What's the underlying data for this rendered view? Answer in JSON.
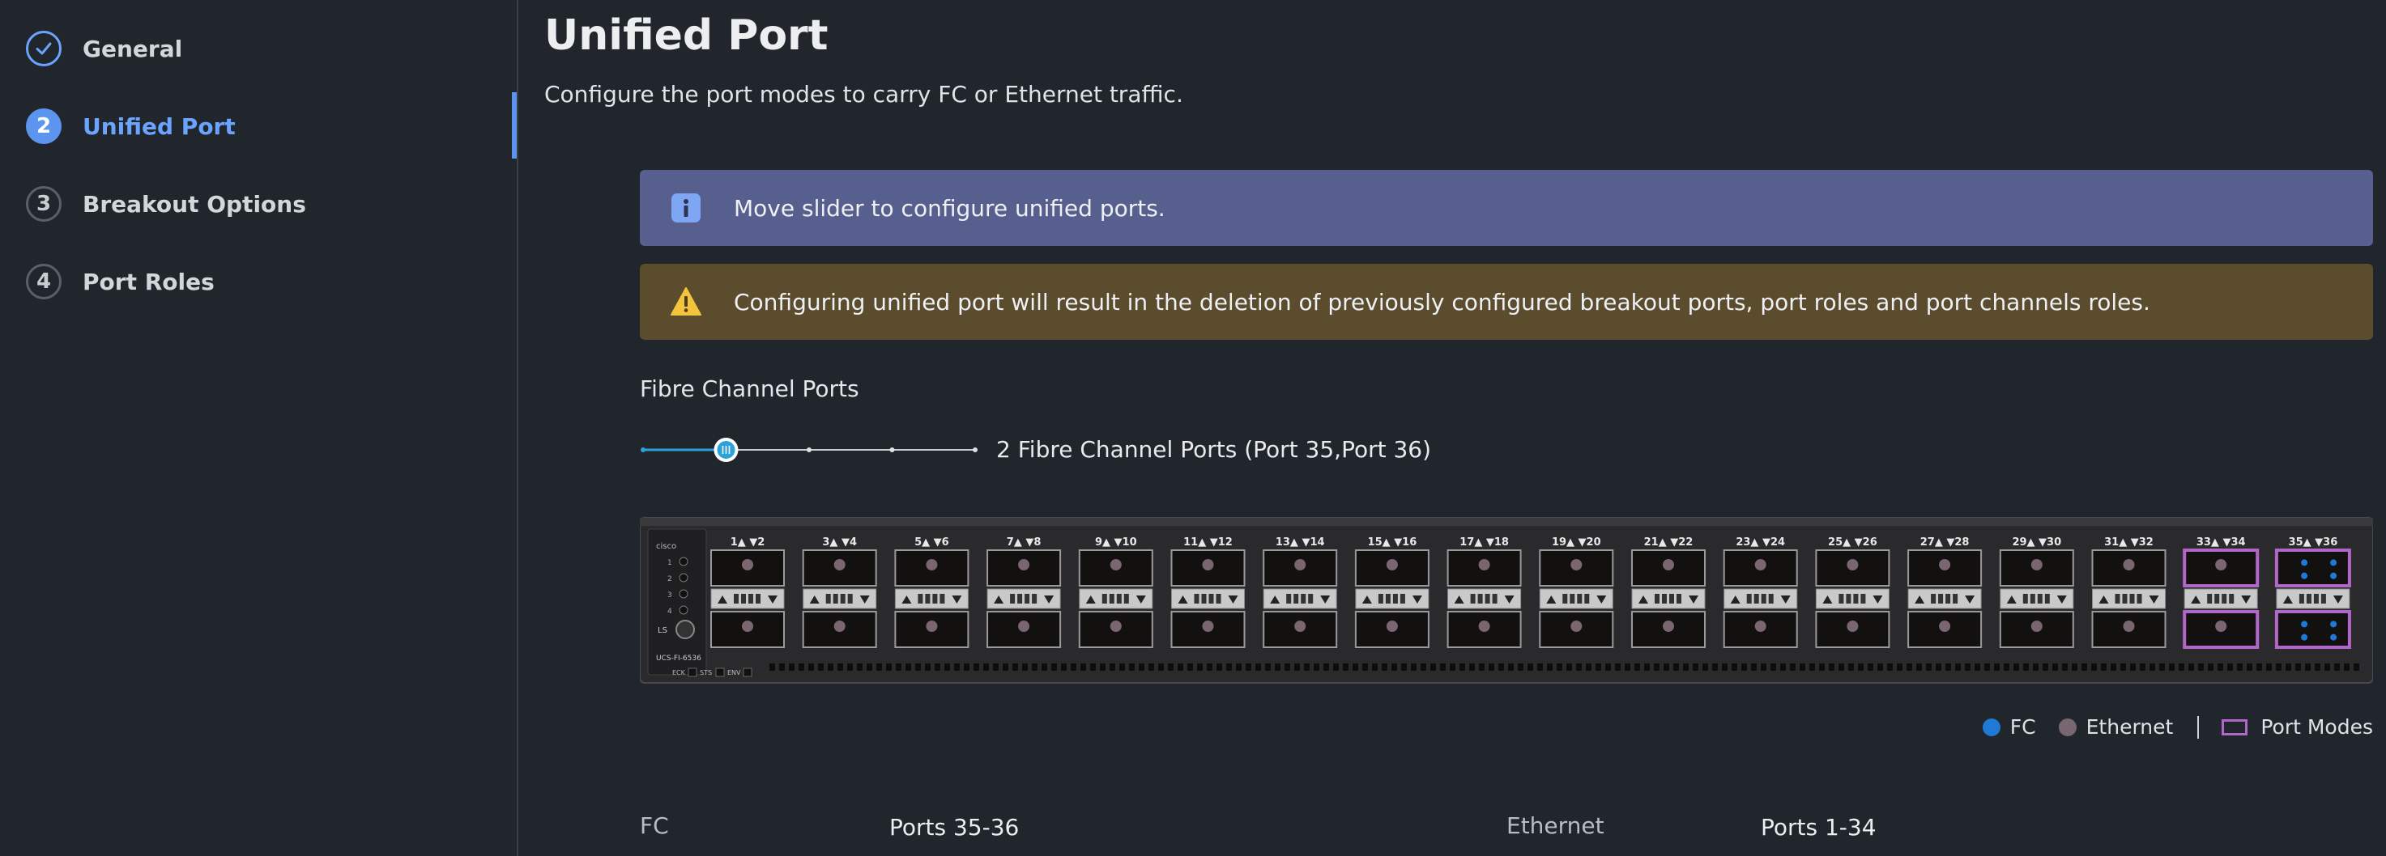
{
  "steps": [
    {
      "number": "",
      "label": "General",
      "state": "done"
    },
    {
      "number": "2",
      "label": "Unified Port",
      "state": "active"
    },
    {
      "number": "3",
      "label": "Breakout Options",
      "state": "pending"
    },
    {
      "number": "4",
      "label": "Port Roles",
      "state": "pending"
    }
  ],
  "page": {
    "title": "Unified Port",
    "subtitle": "Configure the port modes to carry FC or Ethernet traffic."
  },
  "banners": {
    "info": "Move slider to configure unified ports.",
    "warning": "Configuring unified port will result in the deletion of previously configured breakout ports, port roles and port channels roles."
  },
  "fc_ports": {
    "label": "Fibre Channel Ports",
    "slider_value": 2,
    "slider_max": 8,
    "value_text": "2 Fibre Channel Ports (Port 35,Port 36)"
  },
  "switch": {
    "brand": "cisco",
    "model": "UCS-FI-6536",
    "status_leds": [
      "1",
      "2",
      "3",
      "4"
    ],
    "ls_label": "LS",
    "bottom_labels": [
      "ECK",
      "STS",
      "ENV"
    ],
    "port_pairs": [
      "1▲ ▼2",
      "3▲ ▼4",
      "5▲ ▼6",
      "7▲ ▼8",
      "9▲ ▼10",
      "11▲ ▼12",
      "13▲ ▼14",
      "15▲ ▼16",
      "17▲ ▼18",
      "19▲ ▼20",
      "21▲ ▼22",
      "23▲ ▼24",
      "25▲ ▼26",
      "27▲ ▼28",
      "29▲ ▼30",
      "31▲ ▼32",
      "33▲ ▼34",
      "35▲ ▼36"
    ],
    "pair_modes": [
      "ethernet",
      "ethernet",
      "ethernet",
      "ethernet",
      "ethernet",
      "ethernet",
      "ethernet",
      "ethernet",
      "ethernet",
      "ethernet",
      "ethernet",
      "ethernet",
      "ethernet",
      "ethernet",
      "ethernet",
      "ethernet",
      "port-mode",
      "fc"
    ]
  },
  "legend": {
    "fc": "FC",
    "ethernet": "Ethernet",
    "port_modes": "Port Modes"
  },
  "summary": {
    "fc_label": "FC",
    "fc_value": "Ports 35-36",
    "eth_label": "Ethernet",
    "eth_value": "Ports 1-34"
  },
  "colors": {
    "accent": "#5c95f0",
    "fc": "#1f7ad6",
    "ethernet": "#7a6670",
    "port_mode_border": "#b366c9"
  }
}
